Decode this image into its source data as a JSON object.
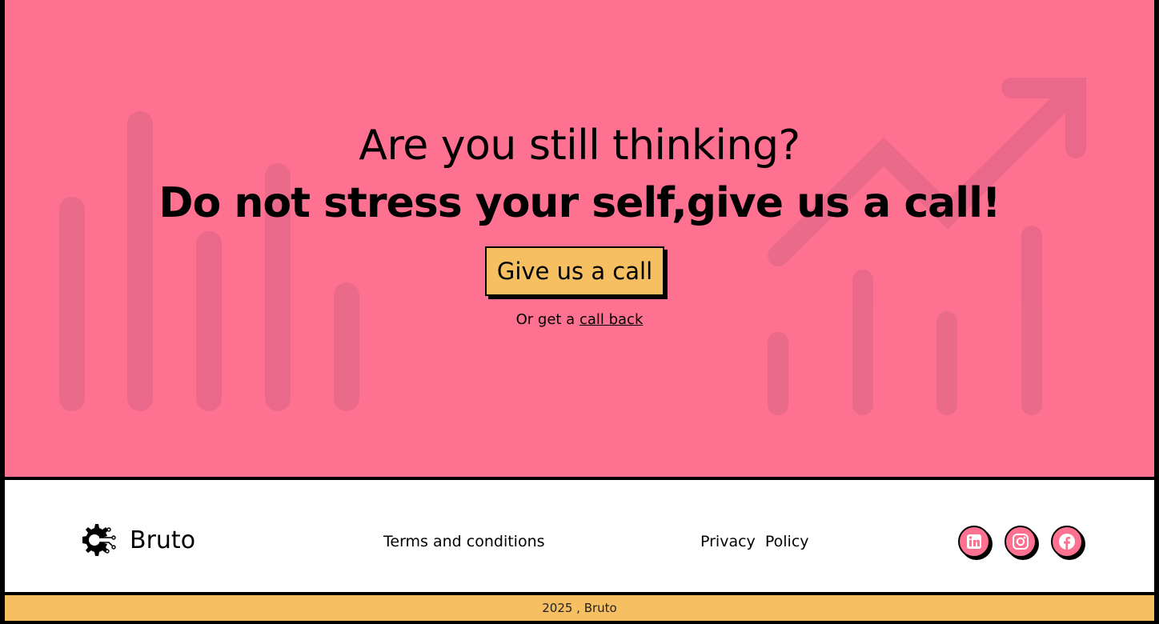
{
  "colors": {
    "hero_bg": "#ff7190",
    "accent": "#f5bf62",
    "footer_bg": "#ffffff",
    "border": "#000000"
  },
  "hero": {
    "headline_1": "Are you still thinking?",
    "headline_2": "Do not stress your self,give us a call!",
    "cta_label": "Give us a call",
    "callback_prefix": "Or get a ",
    "callback_link": "call back"
  },
  "footer": {
    "brand_name": "Bruto",
    "brand_icon": "gear-circuit-icon",
    "links": {
      "terms": "Terms and conditions",
      "privacy": "Privacy  Policy"
    },
    "social": [
      "linkedin-icon",
      "instagram-icon",
      "facebook-icon"
    ],
    "copyright": "2025 , Bruto"
  }
}
